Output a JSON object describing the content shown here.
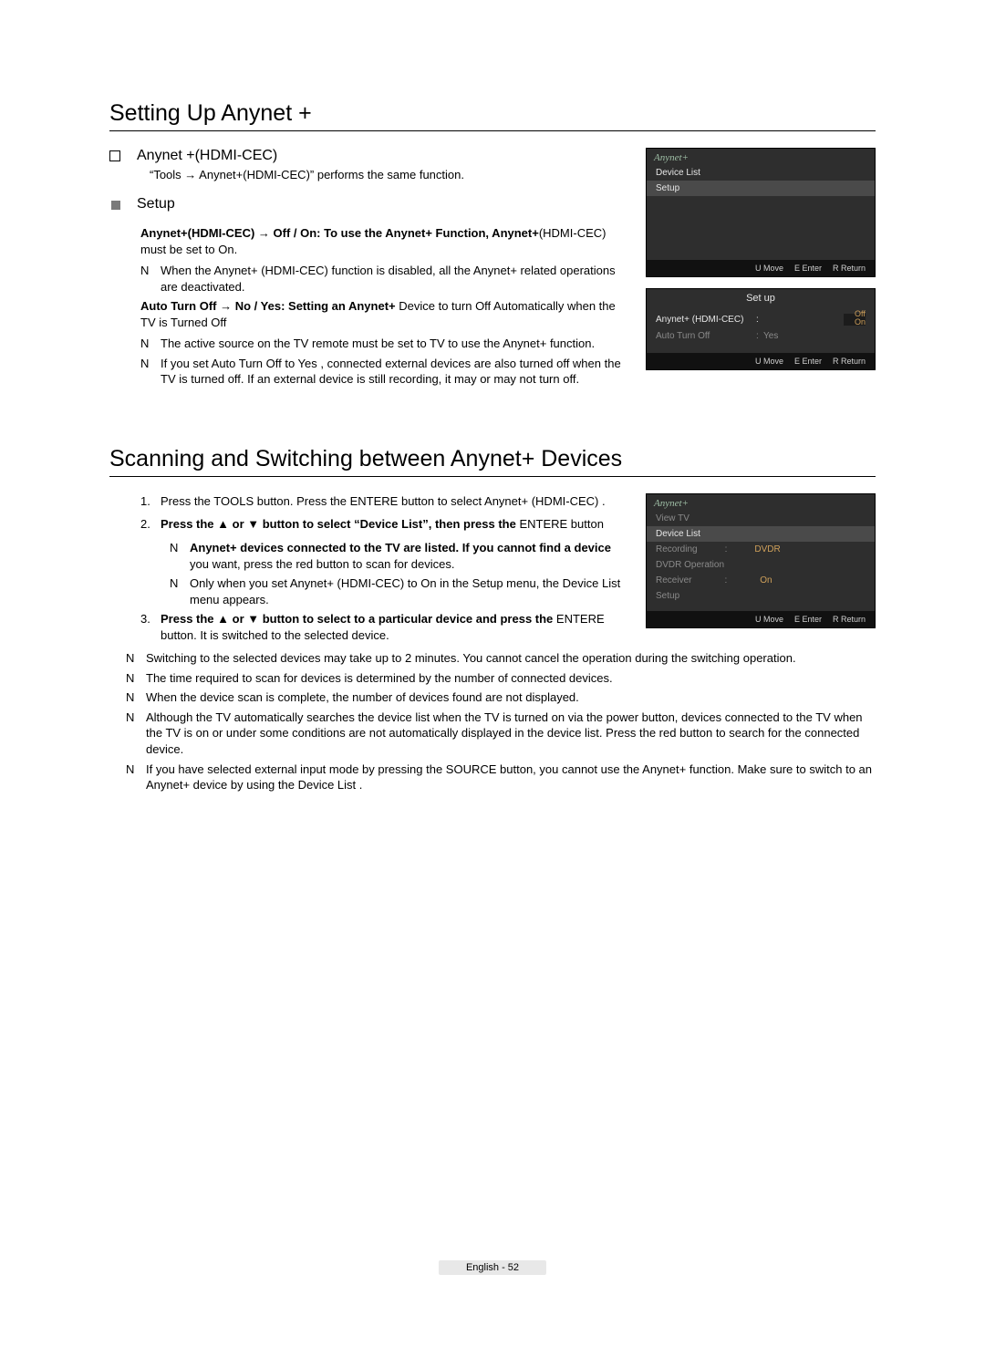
{
  "sec1": {
    "title": "Setting Up Anynet  +",
    "h_anynet": "Anynet +(HDMI-CEC)",
    "p_tools": "“Tools → Anynet+(HDMI-CEC)” performs the same function.",
    "h_setup": "Setup",
    "p_setup_b": "Anynet+(HDMI-CEC) → Off / On: To use the Anynet+ Function, Anynet+",
    "p_setup_c": "(HDMI-CEC) must be set to On.",
    "n1": "When the  Anynet+ (HDMI-CEC)  function is disabled, all the Anynet+ related operations are deactivated.",
    "p_auto_b": "Auto Turn Off → No / Yes: Setting an Anynet+",
    "p_auto_c": " Device to turn Off Automatically when the TV is Turned Off",
    "n2": "The active source on the TV remote must be set to TV to use the Anynet+ function.",
    "n3": "If you set  Auto Turn Off  to  Yes , connected external devices are also turned off when the TV is turned off. If an external device is still recording, it may or may not turn off."
  },
  "osd1": {
    "brand": "Anynet+",
    "r1": "Device List",
    "r2": "Setup",
    "f_move": "U  Move",
    "f_enter": "E  Enter",
    "f_return": "R  Return"
  },
  "osd2": {
    "title": "Set up",
    "k1": "Anynet+ (HDMI-CEC)",
    "v1a": "Off",
    "v1b": "On",
    "k2": "Auto Turn Off",
    "v2": "Yes",
    "f_move": "U  Move",
    "f_enter": "E  Enter",
    "f_return": "R  Return"
  },
  "sec2": {
    "title": "Scanning and Switching between Anynet+ Devices",
    "ol1": "Press the TOOLS button. Press the ENTERE    button to select  Anynet+ (HDMI-CEC) .",
    "ol2b": "Press the ▲ or ▼ button to select “Device List”, then press the ",
    "ol2c": "ENTERE button",
    "sn1b": "Anynet+ devices connected to the TV are listed. If you cannot find a device",
    "sn1c": " you want, press the red button to scan for devices.",
    "sn2": "Only when you set  Anynet+ (HDMI-CEC)  to On in the  Setup  menu, the  Device List  menu appears.",
    "ol3b": "Press the ▲ or ▼ button to select to a particular device and press the",
    "ol3c": " ENTERE    button. It is switched to the selected device.",
    "nn1": "Switching to the selected devices may take up to 2 minutes. You cannot cancel the operation during the switching operation.",
    "nn2": "The time required to scan for devices is determined by the number of connected devices.",
    "nn3": "When the device scan is complete, the number of devices found are not displayed.",
    "nn4": "Although the TV automatically searches the device list when the TV is turned on via the power button, devices connected to the TV when the TV is on or under some conditions are not automatically displayed in the device list. Press the red button to search for the connected device.",
    "nn5": "If you have selected external input mode by pressing the SOURCE button, you cannot use the Anynet+ function. Make sure to switch to an Anynet+ device by using the  Device List ."
  },
  "osd3": {
    "brand": "Anynet+",
    "r1": "View TV",
    "r2": "Device List",
    "r3": "Recording",
    "r3v": "DVDR",
    "r4": "DVDR Operation",
    "r5": "Receiver",
    "r5v": "On",
    "r6": "Setup",
    "f_move": "U  Move",
    "f_enter": "E  Enter",
    "f_return": "R  Return"
  },
  "footer": "English - 52",
  "N": "N"
}
